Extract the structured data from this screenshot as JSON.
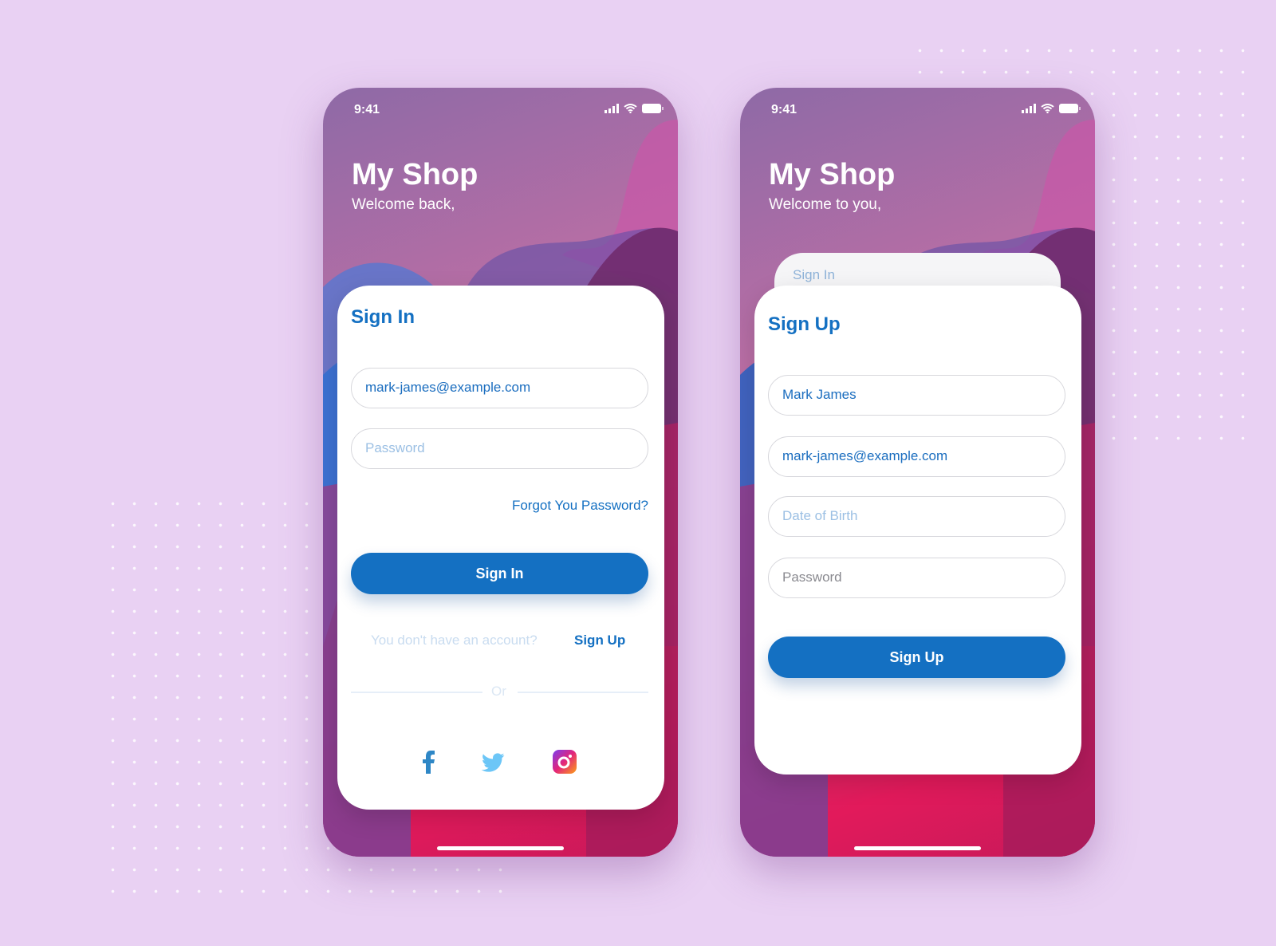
{
  "colors": {
    "accent": "#1470c2",
    "background": "#e9d1f3"
  },
  "signin_screen": {
    "status_time": "9:41",
    "title": "My Shop",
    "subtitle": "Welcome back,",
    "card_title": "Sign In",
    "email_value": "mark-james@example.com",
    "password_placeholder": "Password",
    "forgot_link": "Forgot You Password?",
    "submit_label": "Sign In",
    "no_account_text": "You don't have an account?",
    "signup_link": "Sign Up",
    "divider_text": "Or",
    "social": [
      "facebook-icon",
      "twitter-icon",
      "instagram-icon"
    ]
  },
  "signup_screen": {
    "status_time": "9:41",
    "title": "My Shop",
    "subtitle": "Welcome to you,",
    "back_tab_label": "Sign In",
    "card_title": "Sign Up",
    "name_value": "Mark James",
    "email_value": "mark-james@example.com",
    "dob_placeholder": "Date of Birth",
    "password_placeholder": "Password",
    "submit_label": "Sign Up"
  }
}
